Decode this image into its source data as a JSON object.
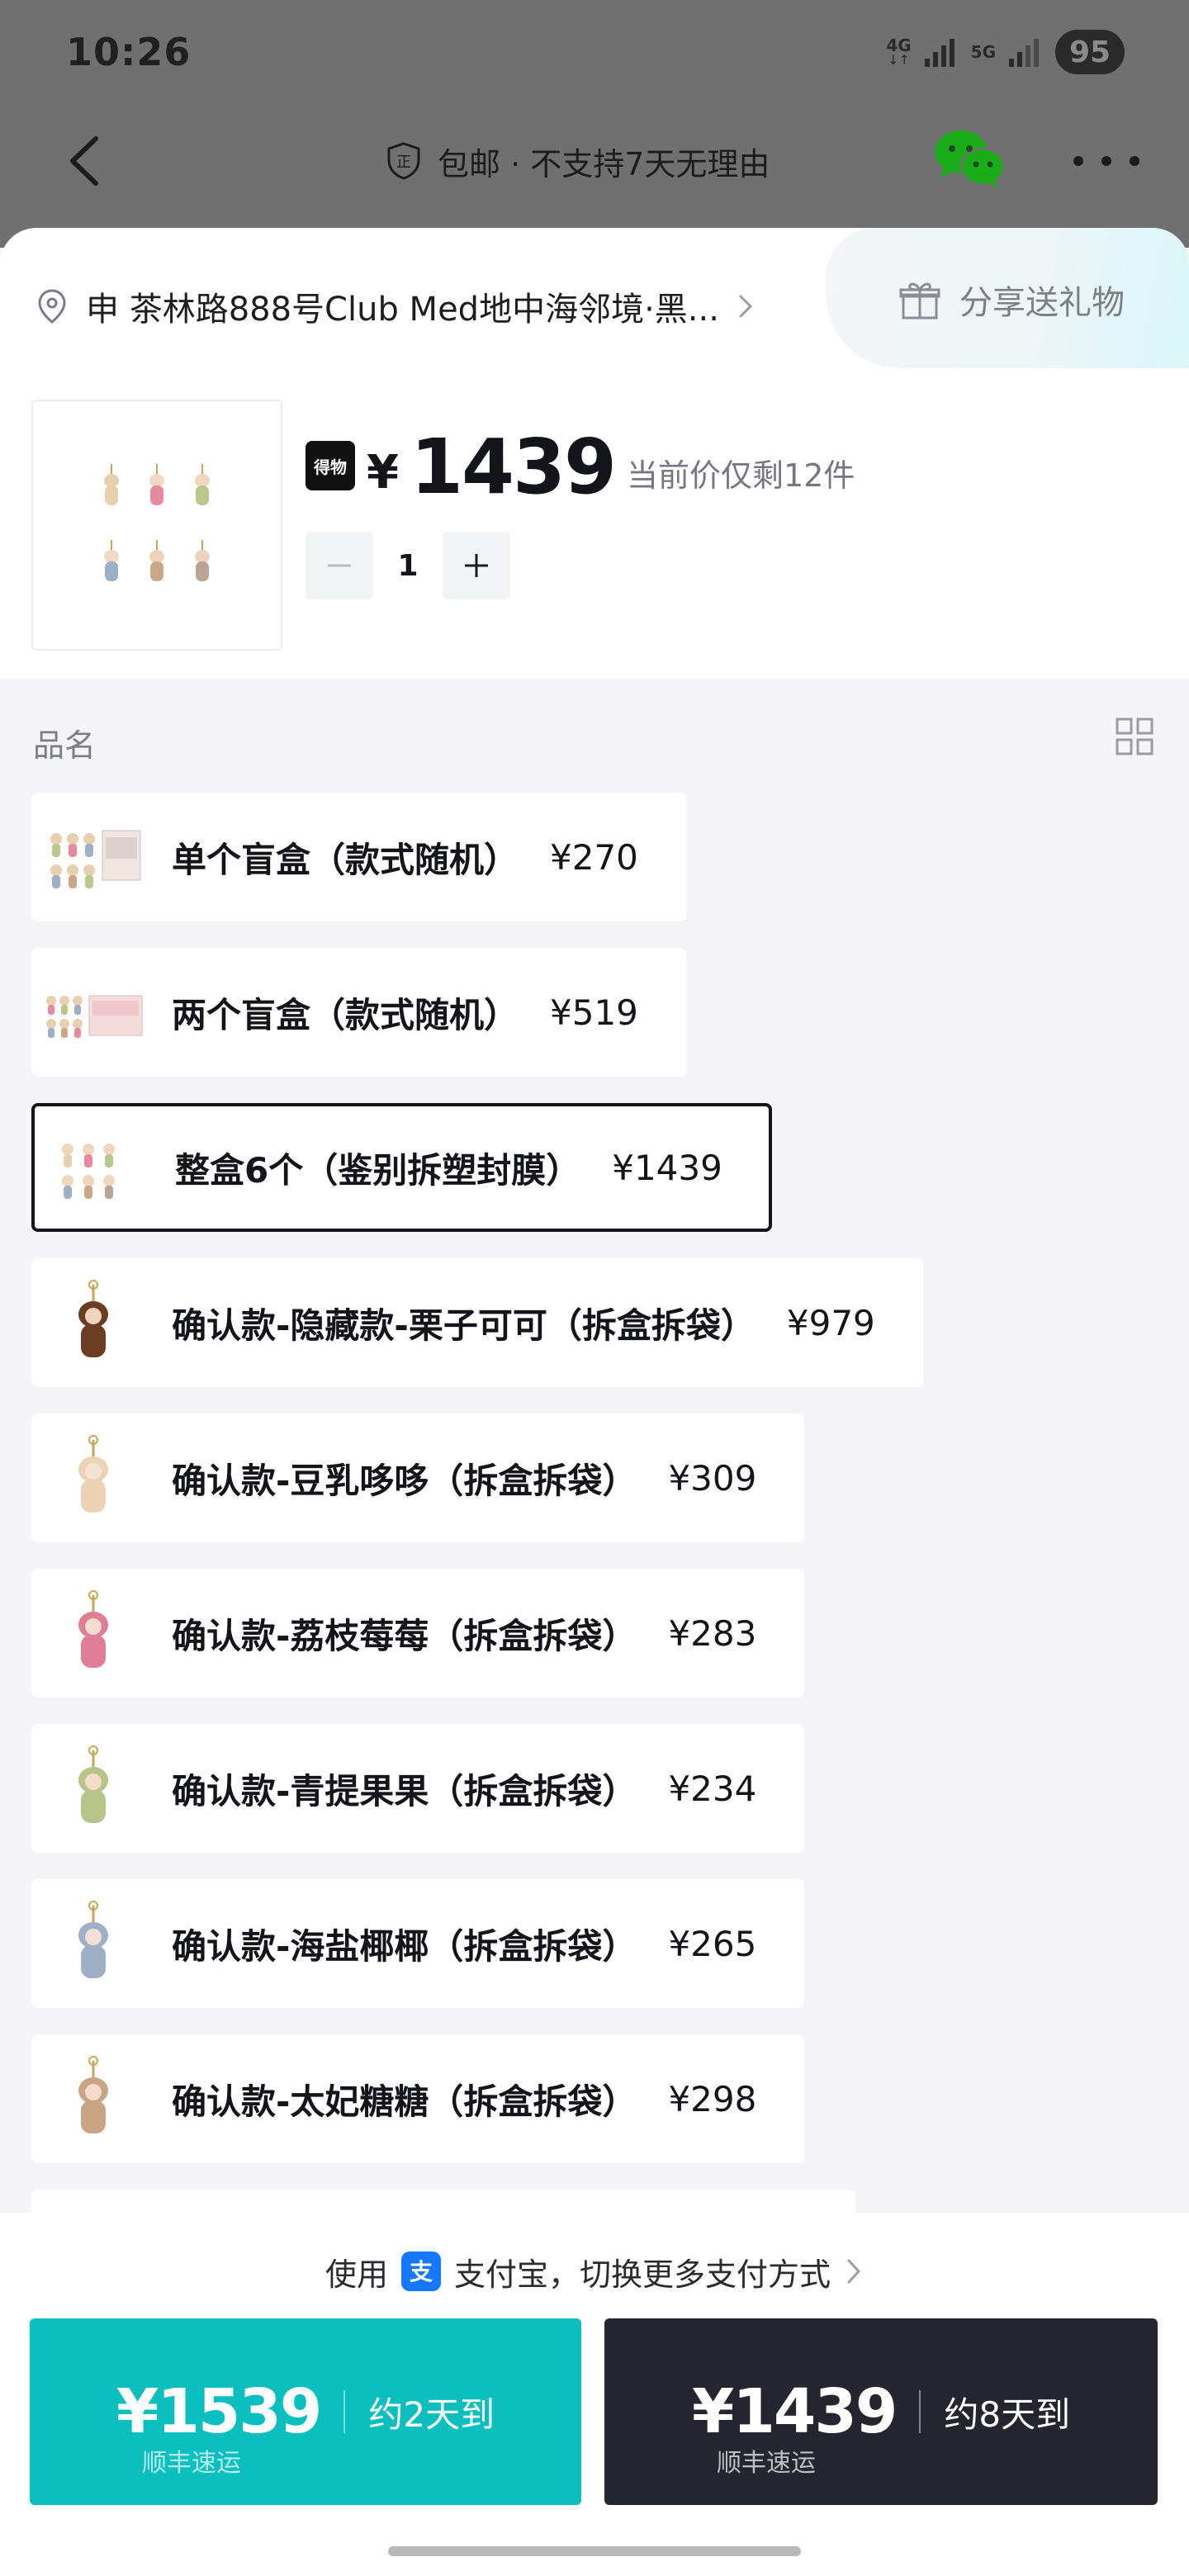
{
  "status_bar": {
    "time": "10:26",
    "network_1": "4G",
    "network_2": "5G",
    "battery": "95"
  },
  "nav": {
    "title": "包邮 · 不支持7天无理由",
    "title_icon": "certified-shield-icon",
    "back_icon": "back-chevron-icon",
    "wechat_icon": "wechat-icon",
    "more_icon": "more-dots-icon"
  },
  "address": {
    "text": "申 茶林路888号Club Med地中海邻境·黑..."
  },
  "gift_tab": {
    "label": "分享送礼物"
  },
  "product": {
    "brand_badge": "得物",
    "currency": "¥",
    "price": "1439",
    "stock_note": "当前价仅剩12件",
    "quantity": "1"
  },
  "spec": {
    "title": "品名",
    "items": [
      {
        "name": "单个盲盒（款式随机）",
        "price": "¥270",
        "selected": false
      },
      {
        "name": "两个盲盒（款式随机）",
        "price": "¥519",
        "selected": false
      },
      {
        "name": "整盒6个（鉴别拆塑封膜）",
        "price": "¥1439",
        "selected": true
      },
      {
        "name": "确认款-隐藏款-栗子可可（拆盒拆袋）",
        "price": "¥979",
        "selected": false
      },
      {
        "name": "确认款-豆乳哆哆（拆盒拆袋）",
        "price": "¥309",
        "selected": false
      },
      {
        "name": "确认款-荔枝莓莓（拆盒拆袋）",
        "price": "¥283",
        "selected": false
      },
      {
        "name": "确认款-青提果果（拆盒拆袋）",
        "price": "¥234",
        "selected": false
      },
      {
        "name": "确认款-海盐椰椰（拆盒拆袋）",
        "price": "¥265",
        "selected": false
      },
      {
        "name": "确认款-太妃糖糖（拆盒拆袋）",
        "price": "¥298",
        "selected": false
      }
    ]
  },
  "payment": {
    "prefix": "使用",
    "method_text": "支付宝，切换更多支付方式"
  },
  "buy_options": [
    {
      "price": "¥1539",
      "eta": "约2天到",
      "carrier": "顺丰速运"
    },
    {
      "price": "¥1439",
      "eta": "约8天到",
      "carrier": "顺丰速运"
    }
  ],
  "colors": {
    "accent_teal": "#0bbfbf",
    "dark_button": "#24252e",
    "alipay_blue": "#1677ff",
    "wechat_green": "#1aad19"
  }
}
